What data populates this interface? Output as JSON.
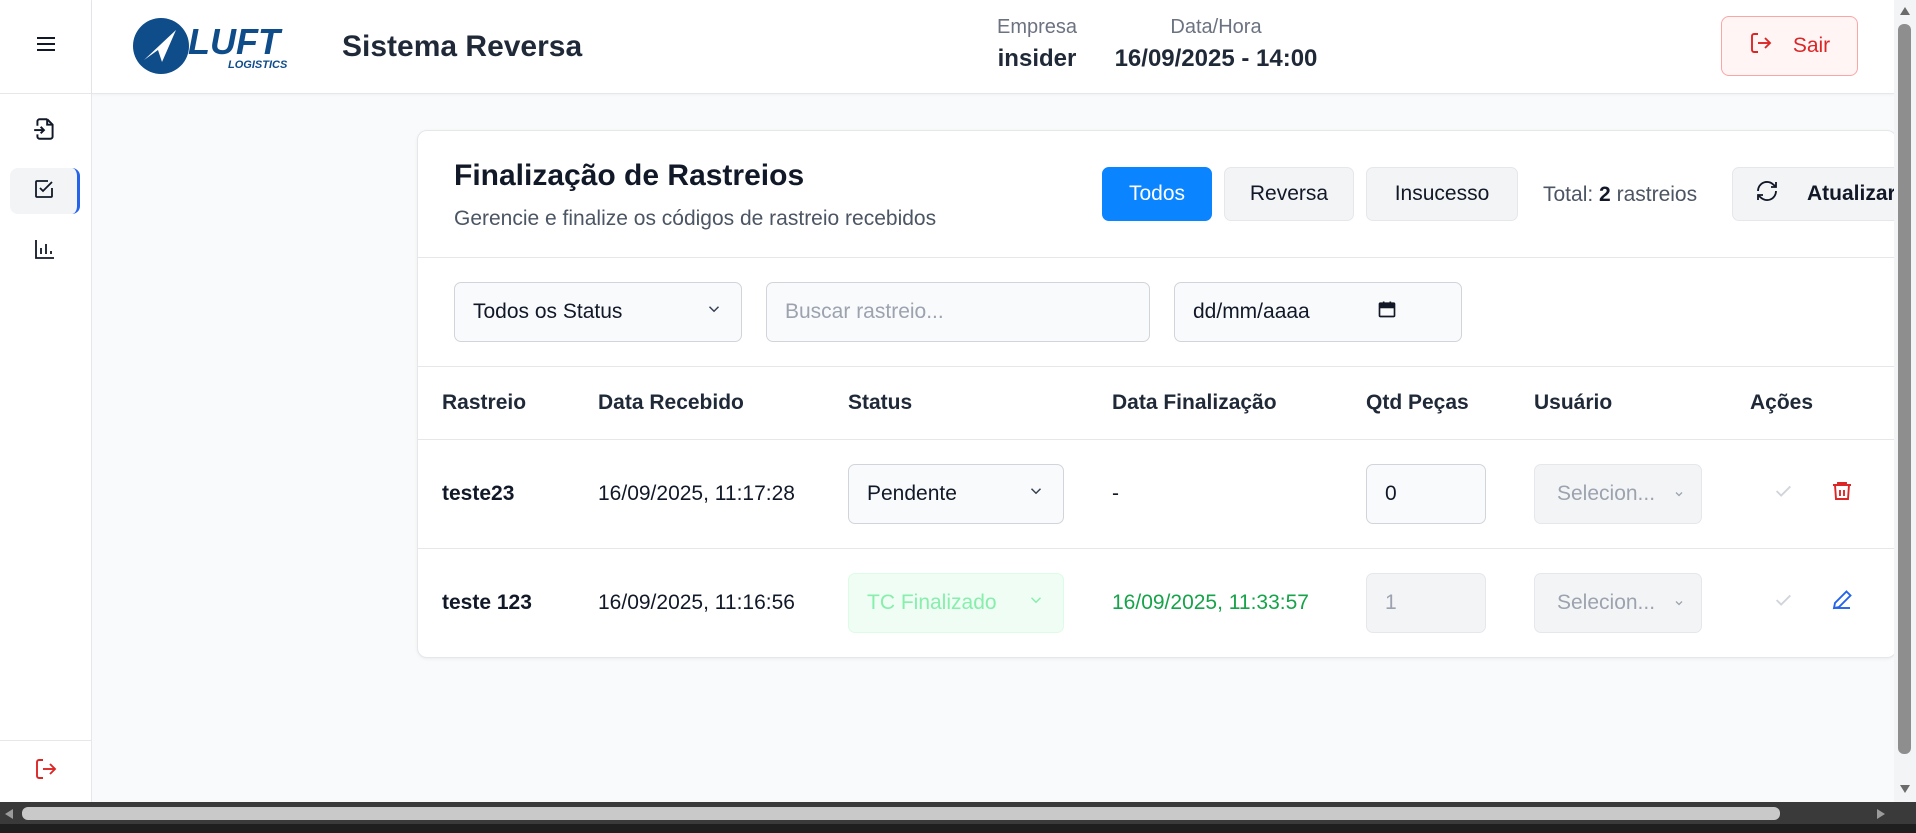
{
  "header": {
    "app_title": "Sistema Reversa",
    "logo_text": "LUFT LOGISTICS",
    "empresa_label": "Empresa",
    "empresa_value": "insider",
    "datahora_label": "Data/Hora",
    "datahora_value": "16/09/2025 - 14:00",
    "logout_label": "Sair"
  },
  "sidebar": {
    "items": [
      {
        "icon": "file-import-icon"
      },
      {
        "icon": "check-square-icon",
        "active": true
      },
      {
        "icon": "bar-chart-icon"
      }
    ],
    "logout_icon": "logout-icon"
  },
  "page": {
    "title": "Finalização de Rastreios",
    "subtitle": "Gerencie e finalize os códigos de rastreio recebidos",
    "filter_buttons": [
      "Todos",
      "Reversa",
      "Insucesso"
    ],
    "active_filter": "Todos",
    "total_prefix": "Total:",
    "total_count": "2",
    "total_suffix": "rastreios",
    "refresh_label": "Atualizar"
  },
  "filters": {
    "status_select": "Todos os Status",
    "search_placeholder": "Buscar rastreio...",
    "date_placeholder": "dd/mm/aaaa"
  },
  "table": {
    "columns": [
      "Rastreio",
      "Data Recebido",
      "Status",
      "Data Finalização",
      "Qtd Peças",
      "Usuário",
      "Ações"
    ],
    "rows": [
      {
        "rastreio": "teste23",
        "data_recebido": "16/09/2025, 11:17:28",
        "status": "Pendente",
        "data_finalizacao": "-",
        "qtd": "0",
        "usuario": "Selecion...",
        "action_icon": "trash-icon"
      },
      {
        "rastreio": "teste 123",
        "data_recebido": "16/09/2025, 11:16:56",
        "status": "TC Finalizado",
        "data_finalizacao": "16/09/2025, 11:33:57",
        "qtd": "1",
        "usuario": "Selecion...",
        "action_icon": "edit-icon"
      }
    ]
  },
  "colors": {
    "primary": "#0a84ff",
    "danger": "#dc2626",
    "success": "#16a34a",
    "brand_blue": "#0e4c8a"
  }
}
